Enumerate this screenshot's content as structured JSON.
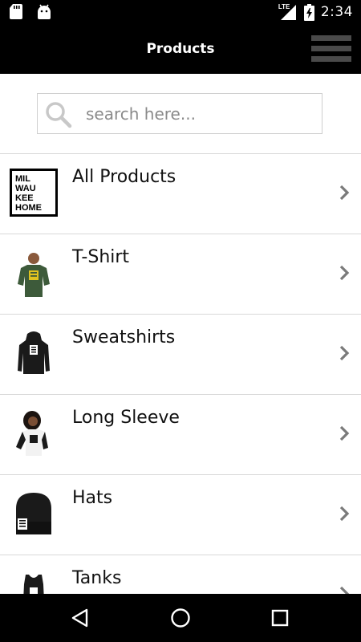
{
  "status_bar": {
    "network": "LTE",
    "time": "2:34"
  },
  "app_bar": {
    "title": "Products"
  },
  "search": {
    "placeholder": "search here...",
    "value": ""
  },
  "products": [
    {
      "label": "All Products",
      "thumb": "milwaukee-home-logo"
    },
    {
      "label": "T-Shirt",
      "thumb": "tshirt-photo"
    },
    {
      "label": "Sweatshirts",
      "thumb": "hoodie-photo"
    },
    {
      "label": "Long Sleeve",
      "thumb": "long-sleeve-photo"
    },
    {
      "label": "Hats",
      "thumb": "beanie-photo"
    },
    {
      "label": "Tanks",
      "thumb": "tank-photo"
    }
  ],
  "logo_text": [
    "MIL",
    "WAU",
    "KEE",
    "HOME"
  ],
  "colors": {
    "bar_background": "#000000",
    "menu_icon": "#4a4a4a",
    "divider": "#d8d8d8",
    "chevron": "#7a7a7a",
    "text": "#111111"
  },
  "icons": {
    "menu": "hamburger-icon",
    "search": "magnifier-icon",
    "row": "chevron-right-icon",
    "back": "back-triangle-icon",
    "home": "home-circle-icon",
    "recents": "recents-square-icon"
  }
}
